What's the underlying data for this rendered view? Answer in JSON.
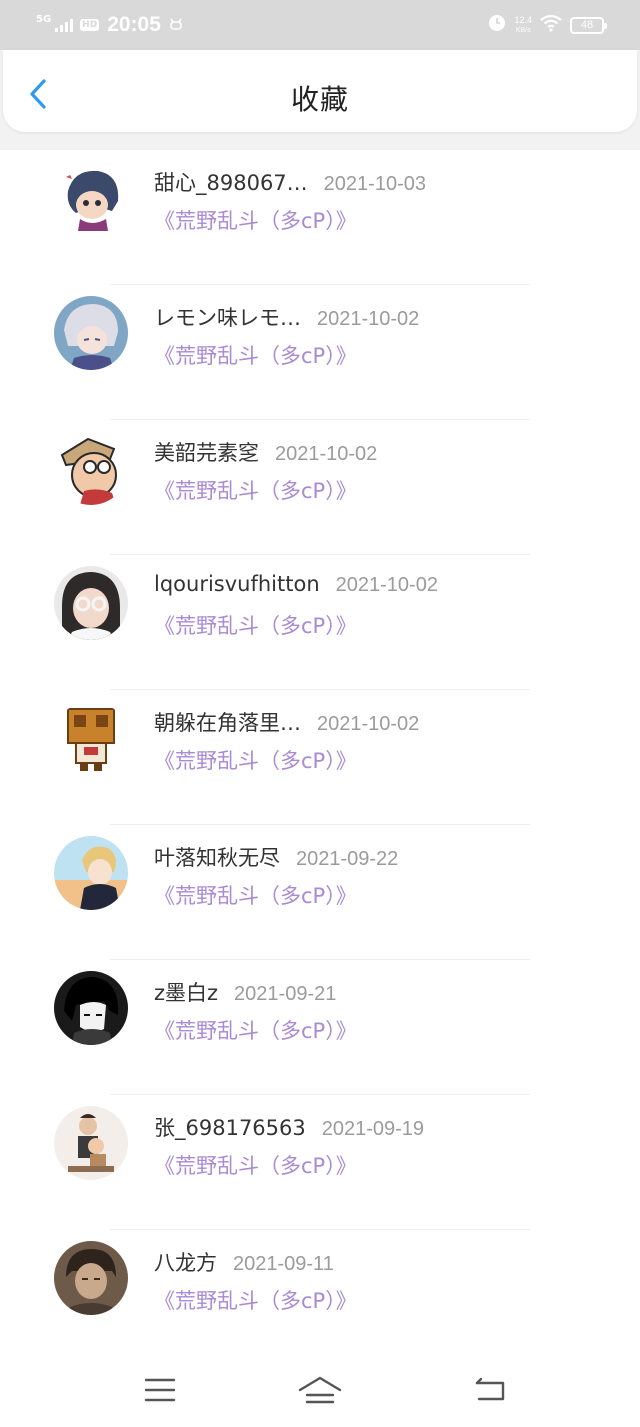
{
  "status_bar": {
    "network": "5G",
    "hd": "HD",
    "time": "20:05",
    "speed_value": "12.4",
    "speed_unit": "KB/s",
    "battery": "48"
  },
  "header": {
    "title": "收藏",
    "back_icon": "chevron-left-icon",
    "accent_color": "#2e9bef"
  },
  "work_link_color": "#a98ad3",
  "items": [
    {
      "name": "甜心_898067…",
      "date": "2021-10-03",
      "work": "《荒野乱斗（多cP）》",
      "avatar": "anime-boy-avatar"
    },
    {
      "name": "レモン味レモ…",
      "date": "2021-10-02",
      "work": "《荒野乱斗（多cP）》",
      "avatar": "anime-silver-hair-avatar"
    },
    {
      "name": "美韶芫素窆",
      "date": "2021-10-02",
      "work": "《荒野乱斗（多cP）》",
      "avatar": "cartoon-man-glasses-avatar"
    },
    {
      "name": "lqourisvufhitton",
      "date": "2021-10-02",
      "work": "《荒野乱斗（多cP）》",
      "avatar": "girl-glasses-photo-avatar"
    },
    {
      "name": "朝躲在角落里…",
      "date": "2021-10-02",
      "work": "《荒野乱斗（多cP）》",
      "avatar": "box-robot-avatar"
    },
    {
      "name": "叶落知秋无尽",
      "date": "2021-09-22",
      "work": "《荒野乱斗（多cP）》",
      "avatar": "anime-blonde-boy-avatar"
    },
    {
      "name": "z墨白z",
      "date": "2021-09-21",
      "work": "《荒野乱斗（多cP）》",
      "avatar": "anime-dark-hair-avatar"
    },
    {
      "name": "张_698176563",
      "date": "2021-09-19",
      "work": "《荒野乱斗（多cP）》",
      "avatar": "child-photo-avatar"
    },
    {
      "name": "八龙方",
      "date": "2021-09-11",
      "work": "《荒野乱斗（多cP）》",
      "avatar": "person-photo-avatar"
    }
  ],
  "nav_bar": {
    "menu_icon": "menu-icon",
    "home_icon": "home-icon",
    "back_icon": "back-icon"
  }
}
